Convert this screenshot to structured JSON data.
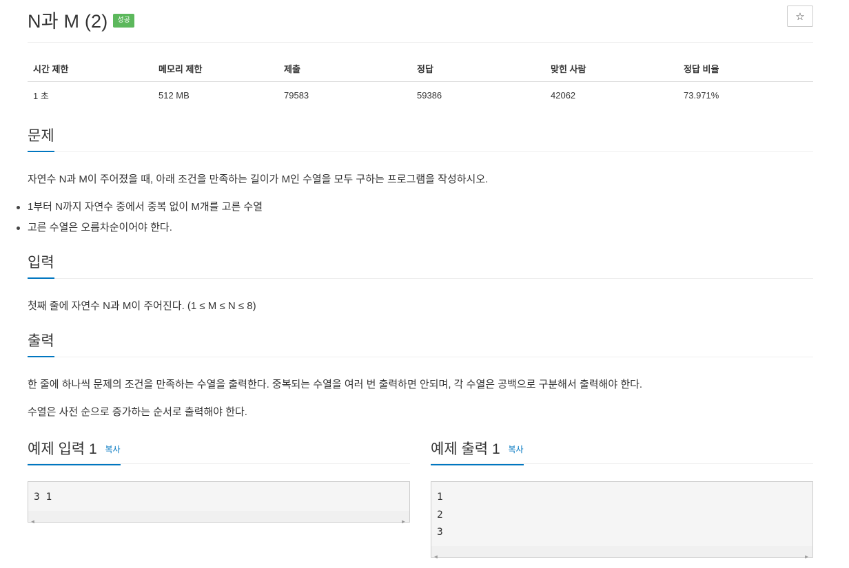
{
  "problem": {
    "title": "N과 M (2)",
    "status_badge": "성공",
    "star_icon": "star-icon"
  },
  "info_table": {
    "headers": [
      "시간 제한",
      "메모리 제한",
      "제출",
      "정답",
      "맞힌 사람",
      "정답 비율"
    ],
    "values": [
      "1 초",
      "512 MB",
      "79583",
      "59386",
      "42062",
      "73.971%"
    ]
  },
  "sections": {
    "problem_heading": "문제",
    "problem_text": "자연수 N과 M이 주어졌을 때, 아래 조건을 만족하는 길이가 M인 수열을 모두 구하는 프로그램을 작성하시오.",
    "conditions": [
      "1부터 N까지 자연수 중에서 중복 없이 M개를 고른 수열",
      "고른 수열은 오름차순이어야 한다."
    ],
    "input_heading": "입력",
    "input_text": "첫째 줄에 자연수 N과 M이 주어진다. (1 ≤ M ≤ N ≤ 8)",
    "output_heading": "출력",
    "output_text_1": "한 줄에 하나씩 문제의 조건을 만족하는 수열을 출력한다. 중복되는 수열을 여러 번 출력하면 안되며, 각 수열은 공백으로 구분해서 출력해야 한다.",
    "output_text_2": "수열은 사전 순으로 증가하는 순서로 출력해야 한다."
  },
  "samples": {
    "input_heading": "예제 입력 1",
    "output_heading": "예제 출력 1",
    "copy_label": "복사",
    "input_value": "3 1",
    "output_value": "1\n2\n3"
  }
}
